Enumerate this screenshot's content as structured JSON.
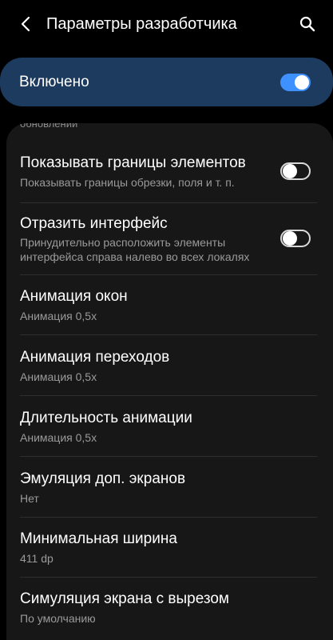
{
  "header": {
    "title": "Параметры разработчика",
    "back_icon": "back-arrow-icon",
    "search_icon": "search-icon"
  },
  "master": {
    "label": "Включено",
    "enabled": true
  },
  "colors": {
    "background": "#000000",
    "master_card": "#1d3b5e",
    "list_card": "#171717",
    "accent": "#3e91ff",
    "subtext": "#9a9a9a"
  },
  "list": {
    "cut_text": "обновлении",
    "items": [
      {
        "title": "Показывать границы элементов",
        "subtitle": "Показывать границы обрезки, поля и т. п.",
        "toggle": false
      },
      {
        "title": "Отразить интерфейс",
        "subtitle_line1": "Принудительно расположить элементы",
        "subtitle_line2": "интерфейса справа налево во всех локалях",
        "toggle": false
      },
      {
        "title": "Анимация окон",
        "subtitle": "Анимация 0,5x"
      },
      {
        "title": "Анимация переходов",
        "subtitle": "Анимация 0,5x"
      },
      {
        "title": "Длительность анимации",
        "subtitle": "Анимация 0,5x"
      },
      {
        "title": "Эмуляция доп. экранов",
        "subtitle": "Нет"
      },
      {
        "title": "Минимальная ширина",
        "subtitle": "411 dp"
      },
      {
        "title": "Симуляция экрана с вырезом",
        "subtitle": "По умолчанию"
      }
    ]
  }
}
